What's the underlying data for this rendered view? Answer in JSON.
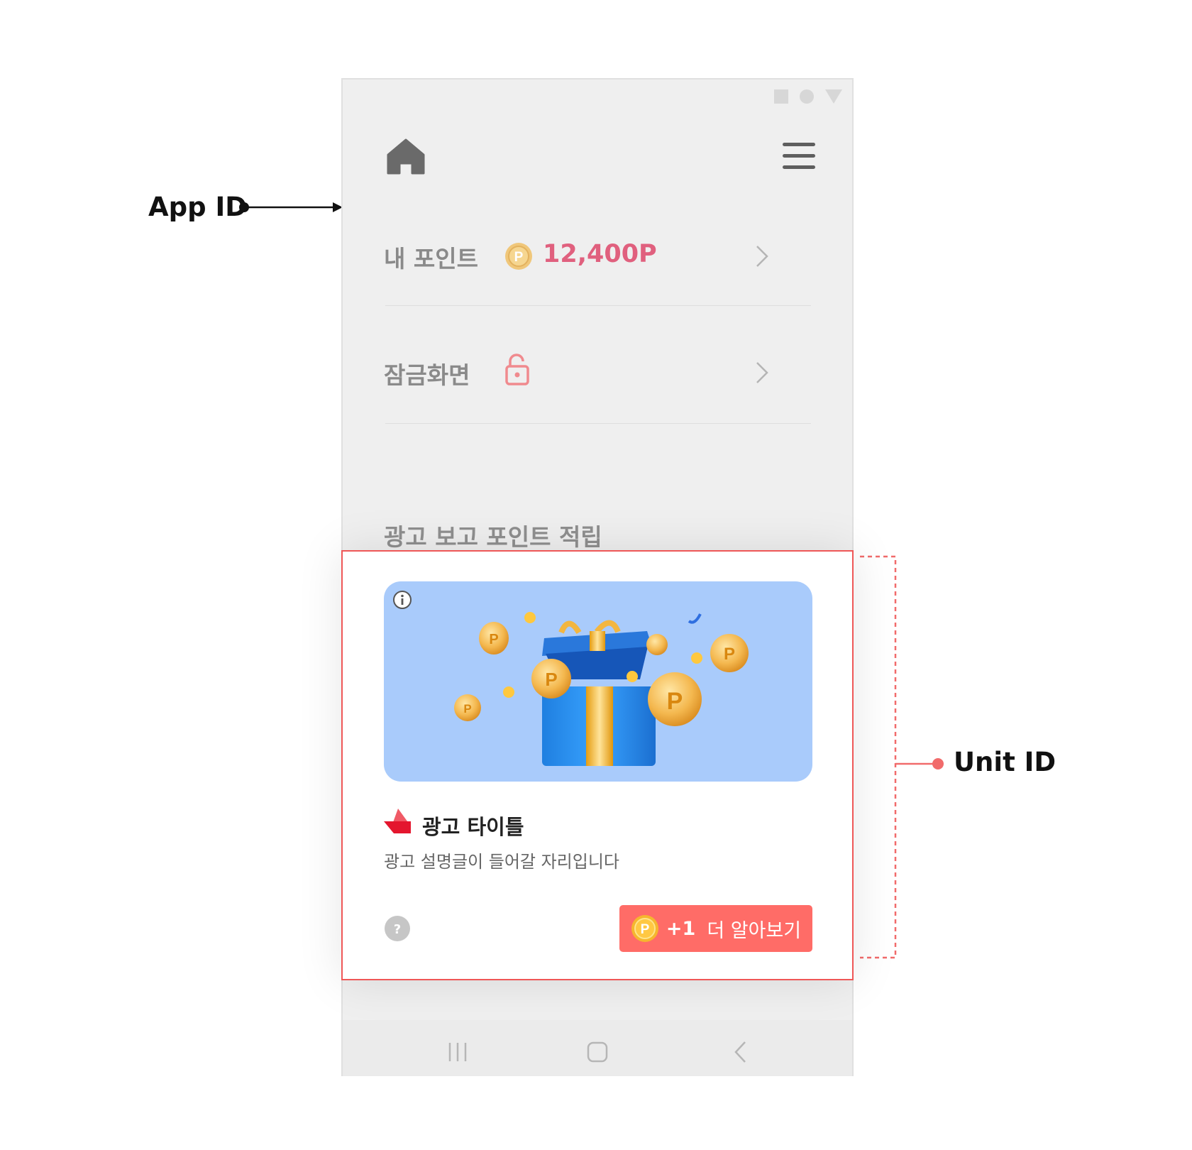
{
  "annotations": {
    "app_id": "App ID",
    "unit_id": "Unit ID"
  },
  "header": {
    "home_icon": "home-icon",
    "menu_icon": "hamburger-menu-icon"
  },
  "rows": [
    {
      "label": "내 포인트",
      "value": "12,400P",
      "icon": "coin-icon"
    },
    {
      "label": "잠금화면",
      "icon": "unlock-icon"
    }
  ],
  "section": {
    "title": "광고 보고 포인트 적립"
  },
  "ad": {
    "title": "광고 타이틀",
    "description": "광고 설명글이 들어갈 자리입니다",
    "cta_bonus": "+1",
    "cta_label": "더 알아보기",
    "help_icon": "?",
    "info_icon": "i"
  },
  "colors": {
    "accent": "#ff6c67",
    "points": "#e0607e",
    "ad_image_bg": "#a9cbfb"
  }
}
